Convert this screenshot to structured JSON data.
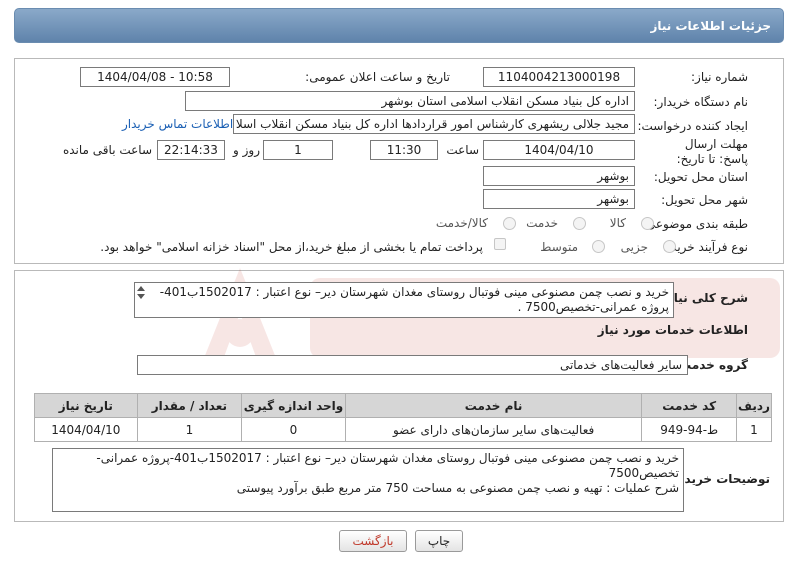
{
  "header": {
    "title": "جزئیات اطلاعات نیاز"
  },
  "form": {
    "need_number_label": "شماره نیاز:",
    "need_number": "1104004213000198",
    "announce_label": "تاریخ و ساعت اعلان عمومی:",
    "announce_value": "1404/04/08 - 10:58",
    "buyer_org_label": "نام دستگاه خریدار:",
    "buyer_org": "اداره کل بنیاد مسکن انقلاب اسلامی استان بوشهر",
    "creator_label": "ایجاد کننده درخواست:",
    "creator": "مجید جلالی ریشهری کارشناس امور قراردادها اداره کل بنیاد مسکن انقلاب اسلا",
    "buyer_contact_link": "اطلاعات تماس خریدار",
    "deadline_label": "مهلت ارسال پاسخ: تا تاریخ:",
    "deadline_date": "1404/04/10",
    "time_label": "ساعت",
    "deadline_time": "11:30",
    "days_value": "1",
    "days_label": "روز و",
    "remaining_time": "22:14:33",
    "remaining_label": "ساعت باقی مانده",
    "province_label": "استان محل تحویل:",
    "province": "بوشهر",
    "city_label": "شهر محل تحویل:",
    "city": "بوشهر",
    "category_label": "طبقه بندی موضوعی:",
    "category_options": [
      "کالا",
      "خدمت",
      "کالا/خدمت"
    ],
    "process_label": "نوع فرآیند خرید :",
    "process_options": [
      "جزیی",
      "متوسط"
    ],
    "payment_note": "پرداخت تمام یا بخشی از مبلغ خرید،از محل \"اسناد خزانه اسلامی\" خواهد بود."
  },
  "summary": {
    "label": "شرح کلی نیاز:",
    "text": "خرید و نصب چمن مصنوعی مینی فوتبال روستای مغدان  شهرستان دیر– نوع اعتبار : 1502017ب401-پروژه عمرانی-تخصیص7500 ."
  },
  "services": {
    "section_title": "اطلاعات خدمات مورد نیاز",
    "group_label": "گروه خدمت:",
    "group_value": "سایر فعالیت‌های خدماتی",
    "columns": [
      "ردیف",
      "کد خدمت",
      "نام خدمت",
      "واحد اندازه گیری",
      "تعداد / مقدار",
      "تاریخ نیاز"
    ],
    "rows": [
      [
        "1",
        "ط-94-949",
        "فعالیت‌های سایر سازمان‌های دارای عضو",
        "0",
        "1",
        "1404/04/10"
      ]
    ]
  },
  "buyer_notes": {
    "label": "توضیحات خریدار:",
    "line1": "خرید و نصب چمن مصنوعی مینی فوتبال روستای مغدان  شهرستان دیر– نوع اعتبار : 1502017ب401-پروژه عمرانی-تخصیص7500",
    "line2": "شرح عملیات : تهیه و نصب چمن مصنوعی به مساحت 750 متر مربع طبق برآورد پیوستی"
  },
  "buttons": {
    "print": "چاپ",
    "back": "بازگشت"
  },
  "colors": {
    "header": "#5f83ab",
    "link": "#1a5fb4",
    "back_text": "#c0392b"
  }
}
